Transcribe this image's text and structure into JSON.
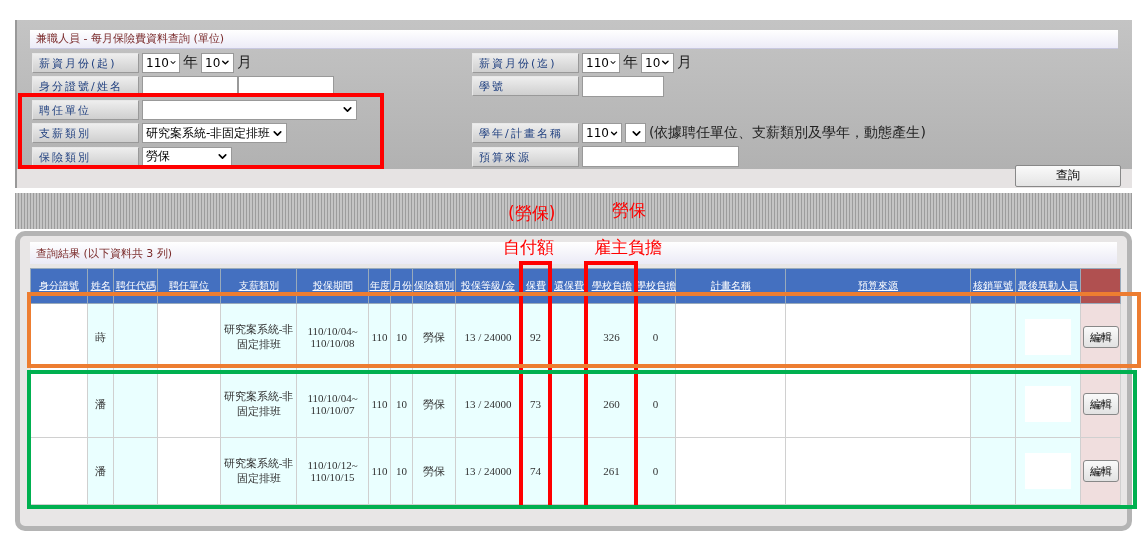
{
  "search_panel": {
    "title": "兼職人員 - 每月保險費資料查詢 (單位)",
    "left_fields": [
      {
        "kind": "month",
        "label": "薪資月份(起)",
        "year": "110",
        "year_unit": "年",
        "month": "10",
        "month_unit": "月"
      },
      {
        "kind": "two_inputs",
        "label": "身分證號/姓名"
      },
      {
        "kind": "wide_select",
        "label": "聘任單位"
      },
      {
        "kind": "select",
        "label": "支薪類別",
        "value": "研究案系統-非固定排班"
      },
      {
        "kind": "short_select",
        "label": "保險類別",
        "value": "勞保"
      }
    ],
    "right_fields": [
      {
        "kind": "month",
        "label": "薪資月份(迄)",
        "year": "110",
        "year_unit": "年",
        "month": "10",
        "month_unit": "月"
      },
      {
        "kind": "input",
        "label": "學號"
      },
      {
        "kind": "blank"
      },
      {
        "kind": "year_plan",
        "label": "學年/計畫名稱",
        "year": "110",
        "note": "(依據聘任單位、支薪類別及學年，動態產生)"
      },
      {
        "kind": "wide_input",
        "label": "預算來源"
      }
    ],
    "query_button": "查詢"
  },
  "results": {
    "title": "查詢結果 (以下資料共 3 列)",
    "columns": [
      {
        "label": "身分證號",
        "kind": "masked"
      },
      {
        "label": "姓名",
        "kind": "text"
      },
      {
        "label": "聘任代碼",
        "kind": "empty"
      },
      {
        "label": "聘任單位",
        "kind": "masked"
      },
      {
        "label": "支薪類別",
        "kind": "text"
      },
      {
        "label": "投保期間",
        "kind": "lines"
      },
      {
        "label": "年度",
        "kind": "text"
      },
      {
        "label": "月份",
        "kind": "text"
      },
      {
        "label": "保險類別",
        "kind": "text"
      },
      {
        "label": "投保等級/金",
        "kind": "text"
      },
      {
        "label": "保費",
        "kind": "text"
      },
      {
        "label": "還保費",
        "kind": "empty"
      },
      {
        "label": "學校負擔",
        "kind": "text"
      },
      {
        "label": "學校負擔",
        "kind": "text"
      },
      {
        "label": "計畫名稱",
        "kind": "masked"
      },
      {
        "label": "預算來源",
        "kind": "masked"
      },
      {
        "label": "核銷單號",
        "kind": "empty"
      },
      {
        "label": "最後異動人員",
        "kind": "masked_inner"
      },
      {
        "kind": "action"
      }
    ],
    "rows": [
      {
        "cells": [
          "",
          "蒔",
          "",
          "",
          "研究案系統-非固定排班",
          [
            "110/10/04~",
            "110/10/08"
          ],
          "110",
          "10",
          "勞保",
          "13 / 24000",
          "92",
          "",
          "326",
          "0",
          "",
          "",
          "",
          "",
          "編輯"
        ]
      },
      {
        "cells": [
          "",
          "潘",
          "",
          "",
          "研究案系統-非固定排班",
          [
            "110/10/04~",
            "110/10/07"
          ],
          "110",
          "10",
          "勞保",
          "13 / 24000",
          "73",
          "",
          "260",
          "0",
          "",
          "",
          "",
          "",
          "編輯"
        ]
      },
      {
        "cells": [
          "",
          "潘",
          "",
          "",
          "研究案系統-非固定排班",
          [
            "110/10/12~",
            "110/10/15"
          ],
          "110",
          "10",
          "勞保",
          "13 / 24000",
          "74",
          "",
          "261",
          "0",
          "",
          "",
          "",
          "",
          "編輯"
        ]
      }
    ]
  },
  "annotations": [
    {
      "kind": "box",
      "color": "#ff0000"
    },
    {
      "kind": "label",
      "text": "(勞保)",
      "color": "#ff0000"
    },
    {
      "kind": "label",
      "text": "勞保",
      "color": "#ff0000"
    },
    {
      "kind": "label",
      "text": "自付額",
      "color": "#ff0000"
    },
    {
      "kind": "label",
      "text": "雇主負擔",
      "color": "#ff0000"
    },
    {
      "kind": "box",
      "color": "#ff0000"
    },
    {
      "kind": "box",
      "color": "#ff0000"
    },
    {
      "kind": "box",
      "color": "#ed7d31"
    },
    {
      "kind": "box",
      "color": "#00b050"
    }
  ]
}
